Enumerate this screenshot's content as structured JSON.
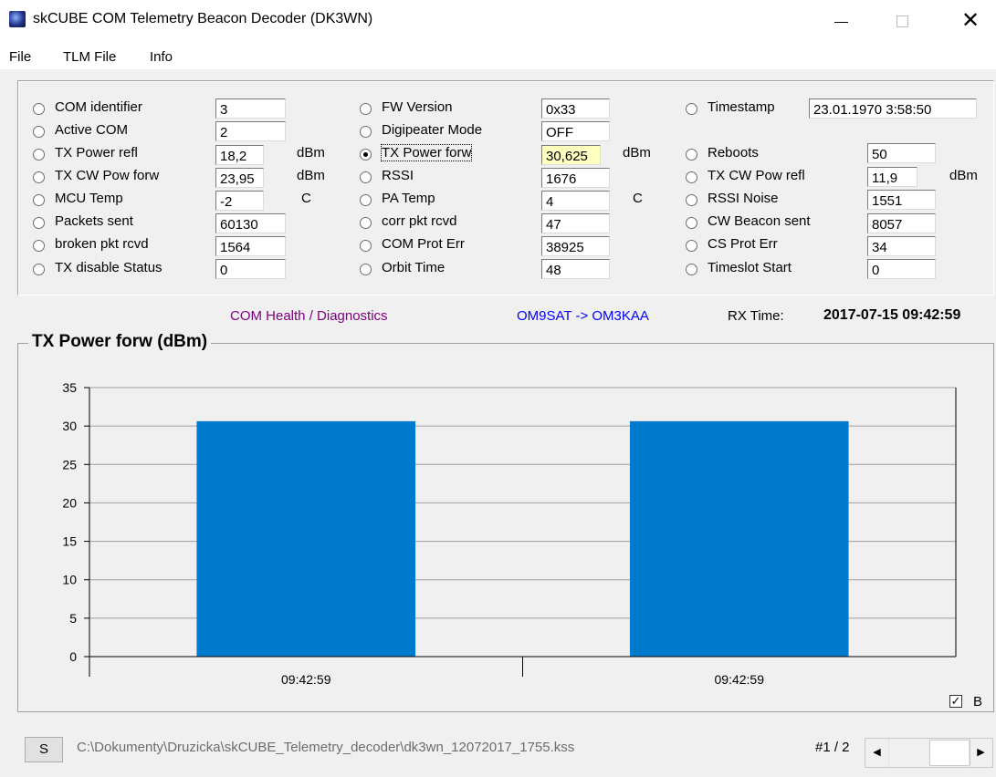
{
  "window": {
    "title": "skCUBE COM Telemetry Beacon Decoder (DK3WN)",
    "minimize_glyph": "",
    "close_glyph": "✕"
  },
  "menu": [
    "File",
    "TLM File",
    "Info"
  ],
  "fields": {
    "col1": [
      {
        "label": "COM identifier",
        "value": "3",
        "unit": ""
      },
      {
        "label": "Active COM",
        "value": "2",
        "unit": ""
      },
      {
        "label": "TX Power refl",
        "value": "18,2",
        "unit": "dBm"
      },
      {
        "label": "TX CW Pow forw",
        "value": "23,95",
        "unit": "dBm"
      },
      {
        "label": "MCU Temp",
        "value": "-2",
        "unit": "C"
      },
      {
        "label": "Packets sent",
        "value": "60130",
        "unit": ""
      },
      {
        "label": "broken pkt rcvd",
        "value": "1564",
        "unit": ""
      },
      {
        "label": "TX disable Status",
        "value": "0",
        "unit": ""
      }
    ],
    "col2": [
      {
        "label": "FW Version",
        "value": "0x33",
        "unit": ""
      },
      {
        "label": "Digipeater Mode",
        "value": "OFF",
        "unit": ""
      },
      {
        "label": "TX Power forw",
        "value": "30,625",
        "unit": "dBm",
        "selected": true
      },
      {
        "label": "RSSI",
        "value": "1676",
        "unit": ""
      },
      {
        "label": "PA Temp",
        "value": "4",
        "unit": "C"
      },
      {
        "label": "corr pkt rcvd",
        "value": "47",
        "unit": ""
      },
      {
        "label": "COM Prot Err",
        "value": "38925",
        "unit": ""
      },
      {
        "label": "Orbit Time",
        "value": "48",
        "unit": ""
      }
    ],
    "col3": [
      {
        "label": "Timestamp",
        "value": "23.01.1970 3:58:50",
        "unit": ""
      },
      {
        "label": "Reboots",
        "value": "50",
        "unit": ""
      },
      {
        "label": "TX CW Pow refl",
        "value": "11,9",
        "unit": "dBm"
      },
      {
        "label": "RSSI Noise",
        "value": "1551",
        "unit": ""
      },
      {
        "label": "CW Beacon sent",
        "value": "8057",
        "unit": ""
      },
      {
        "label": "CS Prot Err",
        "value": "34",
        "unit": ""
      },
      {
        "label": "Timeslot Start",
        "value": "0",
        "unit": ""
      }
    ]
  },
  "status": {
    "health": "COM Health / Diagnostics",
    "route": "OM9SAT -> OM3KAA",
    "rx_label": "RX Time:",
    "rx_time": "2017-07-15 09:42:59"
  },
  "colors": {
    "health": "#800080",
    "route": "#0000ff",
    "bar": "#007acc"
  },
  "chart_data": {
    "type": "bar",
    "title": "TX Power forw (dBm)",
    "categories": [
      "09:42:59",
      "09:42:59"
    ],
    "values": [
      30.625,
      30.625
    ],
    "ylim": [
      0,
      35
    ],
    "yticks": [
      0,
      5,
      10,
      15,
      20,
      25,
      30,
      35
    ],
    "grid": true,
    "xlabel": "",
    "ylabel": ""
  },
  "checkbox": {
    "label": "B",
    "checked": true,
    "mark": "✓"
  },
  "bottom": {
    "s_button": "S",
    "path": "C:\\Dokumenty\\Druzicka\\skCUBE_Telemetry_decoder\\dk3wn_12072017_1755.kss",
    "page": "#1 / 2",
    "scroll_left": "◀",
    "scroll_right": "▶"
  }
}
